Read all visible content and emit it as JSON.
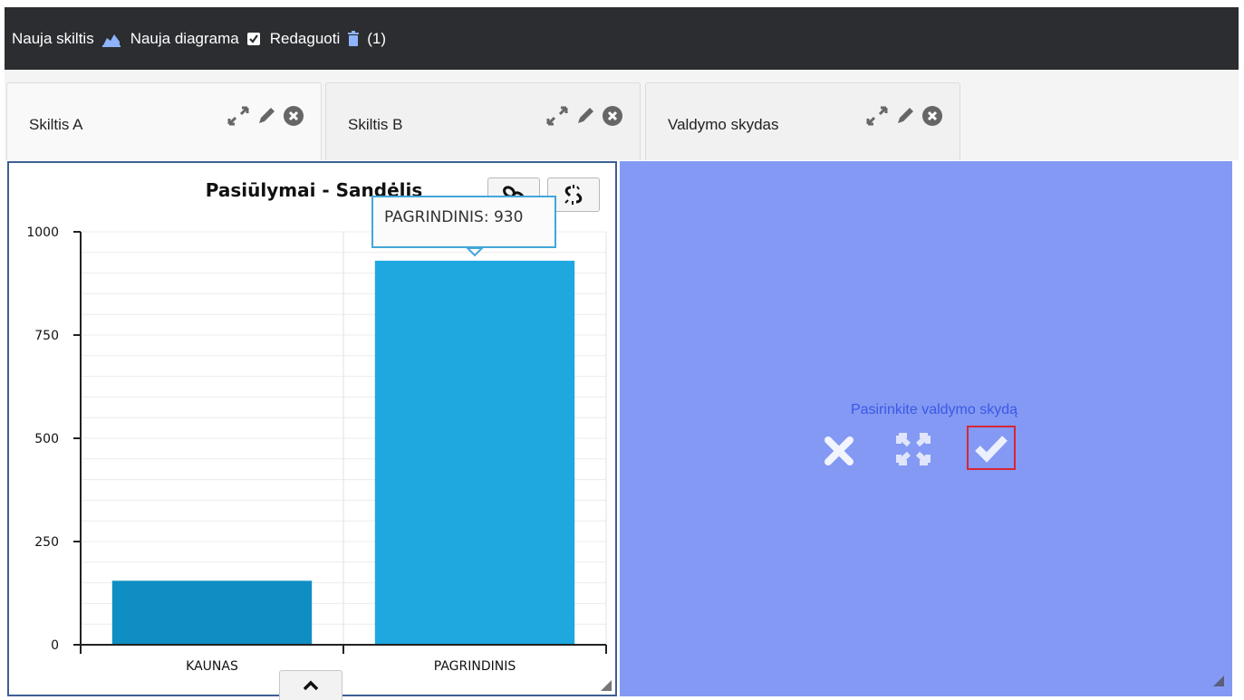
{
  "toolbar": {
    "new_section_label": "Nauja skiltis",
    "new_chart_label": "Nauja diagrama",
    "edit_label": "Redaguoti",
    "edit_checked": true,
    "trash_count": "(1)"
  },
  "tabs": [
    {
      "label": "Skiltis A",
      "active": true
    },
    {
      "label": "Skiltis B",
      "active": false
    },
    {
      "label": "Valdymo skydas",
      "active": false
    }
  ],
  "tab_icons": [
    "expand-icon",
    "pencil-icon",
    "close-circle-icon"
  ],
  "chart_data": {
    "type": "bar",
    "title": "Pasiūlymai - Sandėlis",
    "categories": [
      "KAUNAS",
      "PAGRINDINIS"
    ],
    "values": [
      155,
      930
    ],
    "colors": [
      "#0f8ec4",
      "#1ea8df"
    ],
    "ylim": [
      0,
      1000
    ],
    "yticks": [
      0,
      250,
      500,
      750,
      1000
    ],
    "grid": true,
    "tooltip": "PAGRINDINIS: 930"
  },
  "chart_buttons": [
    "link-icon",
    "unlink-icon"
  ],
  "dashboard_panel": {
    "label": "Pasirinkite valdymo skydą",
    "actions": [
      "close-icon",
      "fullscreen-icon",
      "check-icon"
    ],
    "background": "#8399f3"
  },
  "colors": {
    "topbar": "#2b2d31",
    "accent": "#3d5f92",
    "highlight": "#d72638"
  }
}
